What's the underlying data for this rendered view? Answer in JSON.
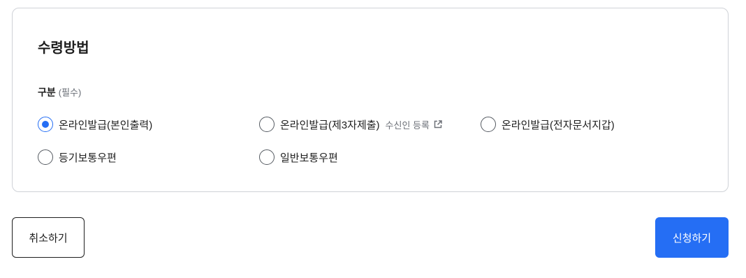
{
  "section": {
    "title": "수령방법",
    "field_label": "구분",
    "required_text": "(필수)"
  },
  "options": [
    {
      "label": "온라인발급(본인출력)",
      "checked": true
    },
    {
      "label": "온라인발급(제3자제출)",
      "checked": false,
      "link_text": "수신인 등록",
      "link_icon": "external-link-icon"
    },
    {
      "label": "온라인발급(전자문서지갑)",
      "checked": false
    },
    {
      "label": "등기보통우편",
      "checked": false
    },
    {
      "label": "일반보통우편",
      "checked": false
    }
  ],
  "buttons": {
    "cancel": "취소하기",
    "submit": "신청하기"
  },
  "colors": {
    "accent": "#256ef4",
    "border": "#cfd2d7",
    "text": "#1e1e1e",
    "muted": "#6d7178"
  }
}
